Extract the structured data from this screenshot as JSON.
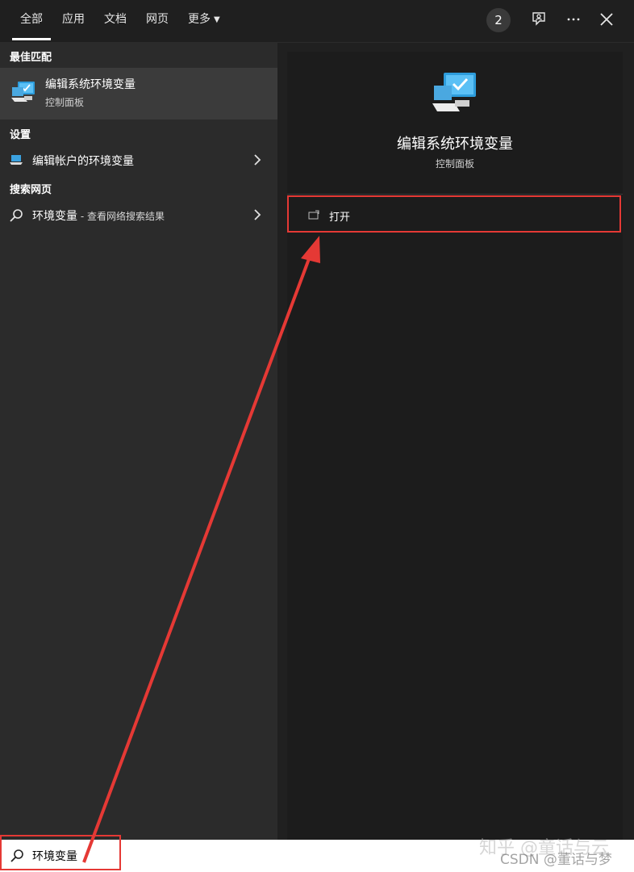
{
  "tabs": [
    {
      "label": "全部",
      "active": true
    },
    {
      "label": "应用"
    },
    {
      "label": "文档"
    },
    {
      "label": "网页"
    },
    {
      "label": "更多"
    }
  ],
  "header": {
    "badge_count": "2",
    "icons": [
      "feedback-icon",
      "more-icon",
      "close-icon"
    ]
  },
  "left": {
    "best_match_header": "最佳匹配",
    "best_match": {
      "title": "编辑系统环境变量",
      "subtitle": "控制面板",
      "icon": "computer-check-icon"
    },
    "settings_header": "设置",
    "settings_item": {
      "label": "编辑帐户的环境变量",
      "icon": "laptop-icon"
    },
    "web_header": "搜索网页",
    "web_item": {
      "label": "环境变量",
      "suffix": " - 查看网络搜索结果",
      "icon": "search-icon"
    }
  },
  "preview": {
    "title": "编辑系统环境变量",
    "subtitle": "控制面板",
    "open_label": "打开",
    "icon": "computer-check-icon"
  },
  "search": {
    "value": "环境变量",
    "icon": "search-icon"
  },
  "watermarks": {
    "zhihu": "知乎 @童话与云",
    "csdn": "CSDN @董话与梦"
  },
  "colors": {
    "accent": "#0078d7",
    "annotation": "#e53935"
  }
}
